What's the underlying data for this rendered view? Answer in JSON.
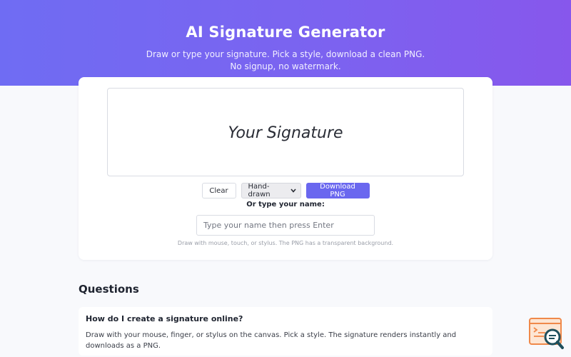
{
  "hero": {
    "title": "AI Signature Generator",
    "subtitle_line1": "Draw or type your signature. Pick a style, download a clean PNG.",
    "subtitle_line2": "No signup, no watermark."
  },
  "canvas": {
    "placeholder_signature": "Your Signature"
  },
  "controls": {
    "clear_label": "Clear",
    "style_selected": "Hand-drawn",
    "download_label": "Download PNG"
  },
  "type_name": {
    "label": "Or type your name:",
    "placeholder": "Type your name then press Enter"
  },
  "hint": "Draw with mouse, touch, or stylus. The PNG has a transparent background.",
  "questions": {
    "title": "Questions",
    "items": [
      {
        "question": "How do I create a signature online?",
        "answer": "Draw with your mouse, finger, or stylus on the canvas. Pick a style. The signature renders instantly and downloads as a PNG."
      }
    ]
  },
  "icons": {
    "chevron": "chevron-down-icon",
    "corner_widget": "search-doc-icon"
  },
  "colors": {
    "accent": "#6a67ef",
    "hero_start": "#6f6cf3",
    "hero_end": "#8757ec",
    "widget_orange": "#f0894a",
    "widget_teal": "#1f4f5c"
  }
}
